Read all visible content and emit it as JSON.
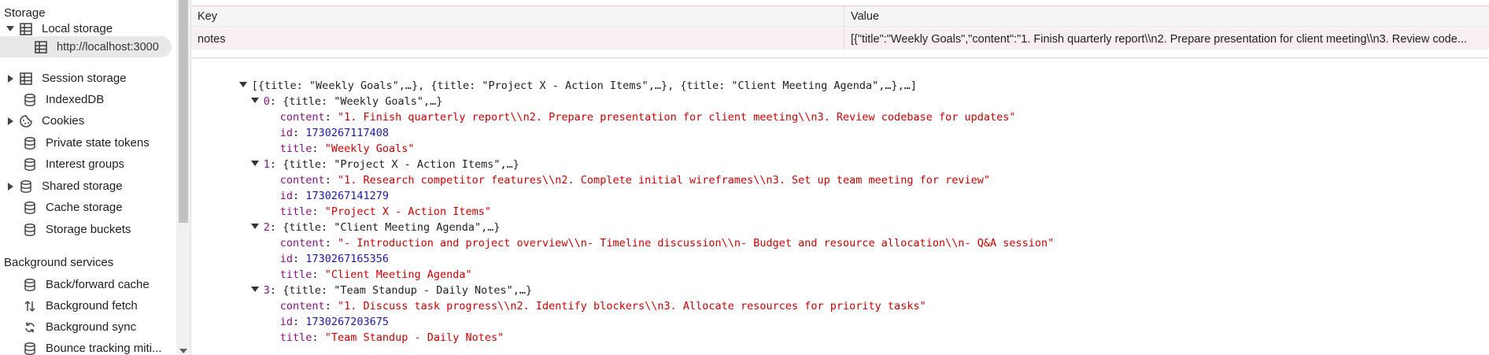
{
  "sidebar": {
    "storage_title": "Storage",
    "local_storage": "Local storage",
    "local_origin": "http://localhost:3000",
    "session_storage": "Session storage",
    "indexeddb": "IndexedDB",
    "cookies": "Cookies",
    "private_state_tokens": "Private state tokens",
    "interest_groups": "Interest groups",
    "shared_storage": "Shared storage",
    "cache_storage": "Cache storage",
    "storage_buckets": "Storage buckets",
    "background_title": "Background services",
    "back_forward_cache": "Back/forward cache",
    "background_fetch": "Background fetch",
    "background_sync": "Background sync",
    "bounce_tracking": "Bounce tracking miti..."
  },
  "table": {
    "key_header": "Key",
    "value_header": "Value",
    "row_key": "notes",
    "row_value": "[{\"title\":\"Weekly Goals\",\"content\":\"1. Finish quarterly report\\\\n2. Prepare presentation for client meeting\\\\n3. Review code..."
  },
  "json": {
    "root_summary": "[{title: \"Weekly Goals\",…}, {title: \"Project X - Action Items\",…}, {title: \"Client Meeting Agenda\",…},…]",
    "items": [
      {
        "index": "0",
        "summary": "{title: \"Weekly Goals\",…}",
        "content": "\"1. Finish quarterly report\\\\n2. Prepare presentation for client meeting\\\\n3. Review codebase for updates\"",
        "id": "1730267117408",
        "title": "\"Weekly Goals\""
      },
      {
        "index": "1",
        "summary": "{title: \"Project X - Action Items\",…}",
        "content": "\"1. Research competitor features\\\\n2. Complete initial wireframes\\\\n3. Set up team meeting for review\"",
        "id": "1730267141279",
        "title": "\"Project X - Action Items\""
      },
      {
        "index": "2",
        "summary": "{title: \"Client Meeting Agenda\",…}",
        "content": "\"- Introduction and project overview\\\\n- Timeline discussion\\\\n- Budget and resource allocation\\\\n- Q&A session\"",
        "id": "1730267165356",
        "title": "\"Client Meeting Agenda\""
      },
      {
        "index": "3",
        "summary": "{title: \"Team Standup - Daily Notes\",…}",
        "content": "\"1. Discuss task progress\\\\n2. Identify blockers\\\\n3. Allocate resources for priority tasks\"",
        "id": "1730267203675",
        "title": "\"Team Standup - Daily Notes\""
      }
    ],
    "key_content": "content",
    "key_id": "id",
    "key_title": "title"
  }
}
